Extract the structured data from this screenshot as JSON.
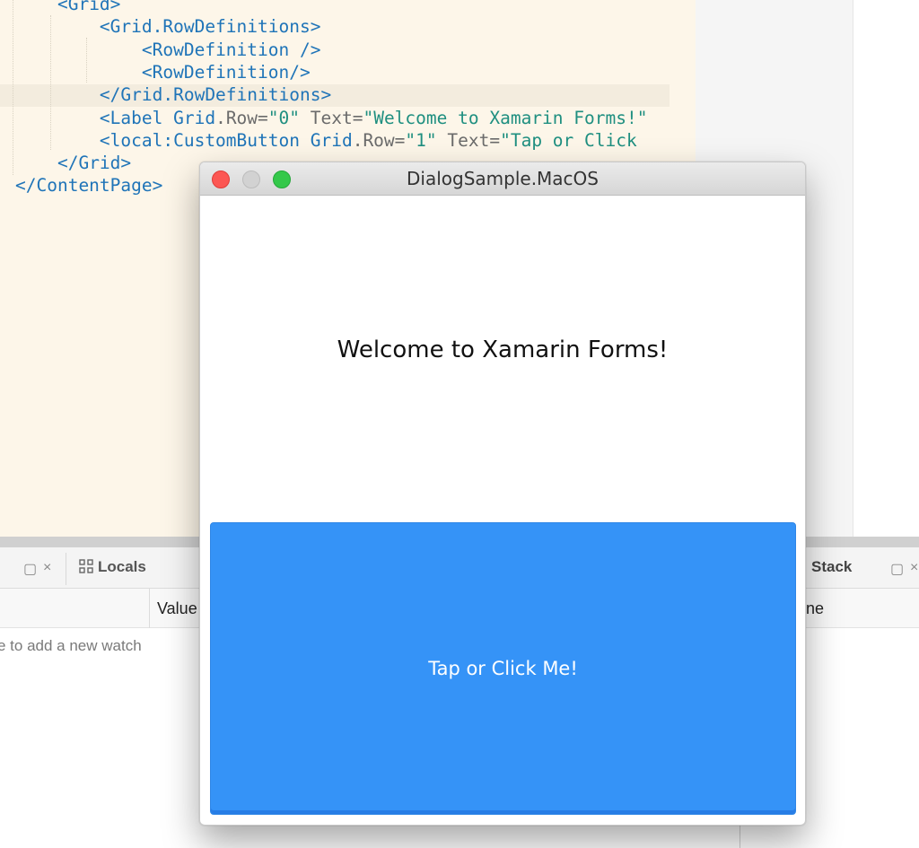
{
  "editor": {
    "lines": [
      {
        "indent": "    ",
        "parts": [
          {
            "t": "tag",
            "v": "<Grid>"
          }
        ]
      },
      {
        "indent": "        ",
        "parts": [
          {
            "t": "tag",
            "v": "<Grid.RowDefinitions>"
          }
        ]
      },
      {
        "indent": "            ",
        "parts": [
          {
            "t": "tag",
            "v": "<RowDefinition />"
          }
        ]
      },
      {
        "indent": "            ",
        "parts": [
          {
            "t": "tag",
            "v": "<RowDefinition/>"
          }
        ]
      },
      {
        "indent": "        ",
        "parts": [
          {
            "t": "tag",
            "v": "</Grid.RowDefinitions>"
          }
        ]
      },
      {
        "indent": "        ",
        "parts": [
          {
            "t": "tag",
            "v": "<Label "
          },
          {
            "t": "tag",
            "v": "Grid"
          },
          {
            "t": "attr",
            "v": ".Row="
          },
          {
            "t": "str",
            "v": "\"0\""
          },
          {
            "t": "attr",
            "v": " Text="
          },
          {
            "t": "str",
            "v": "\"Welcome to Xamarin Forms!\""
          }
        ]
      },
      {
        "indent": "        ",
        "parts": [
          {
            "t": "tag",
            "v": "<local:CustomButton "
          },
          {
            "t": "tag",
            "v": "Grid"
          },
          {
            "t": "attr",
            "v": ".Row="
          },
          {
            "t": "str",
            "v": "\"1\""
          },
          {
            "t": "attr",
            "v": " Text="
          },
          {
            "t": "str",
            "v": "\"Tap or Click"
          }
        ]
      },
      {
        "indent": "    ",
        "parts": [
          {
            "t": "tag",
            "v": "</Grid>"
          }
        ]
      },
      {
        "indent": "",
        "parts": [
          {
            "t": "tag",
            "v": "</ContentPage>"
          }
        ]
      }
    ]
  },
  "pads": {
    "locals_label": "Locals",
    "value_column": "Value",
    "watch_hint": "e to add a new watch",
    "stack_label": "Stack",
    "name_column_partial": "ne",
    "pad_icon": "window-icon",
    "close_glyph": "×"
  },
  "window": {
    "title": "DialogSample.MacOS",
    "welcome_text": "Welcome to Xamarin Forms!",
    "button_label": "Tap or Click Me!",
    "button_color": "#3593f7"
  }
}
